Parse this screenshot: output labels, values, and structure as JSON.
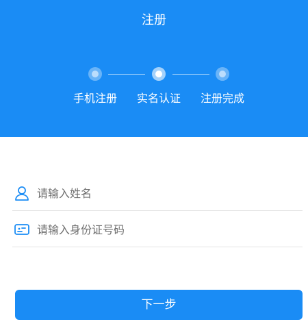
{
  "header": {
    "title": "注册",
    "background_color": "#1a8cf5"
  },
  "steps": [
    {
      "label": "手机注册",
      "state": "done"
    },
    {
      "label": "实名认证",
      "state": "current"
    },
    {
      "label": "注册完成",
      "state": "pending"
    }
  ],
  "form": {
    "name_field": {
      "placeholder": "请输入姓名",
      "value": "",
      "icon": "user-icon"
    },
    "id_field": {
      "placeholder": "请输入身份证号码",
      "value": "",
      "icon": "id-card-icon"
    }
  },
  "actions": {
    "next_label": "下一步",
    "accent_color": "#1a8cf5"
  }
}
